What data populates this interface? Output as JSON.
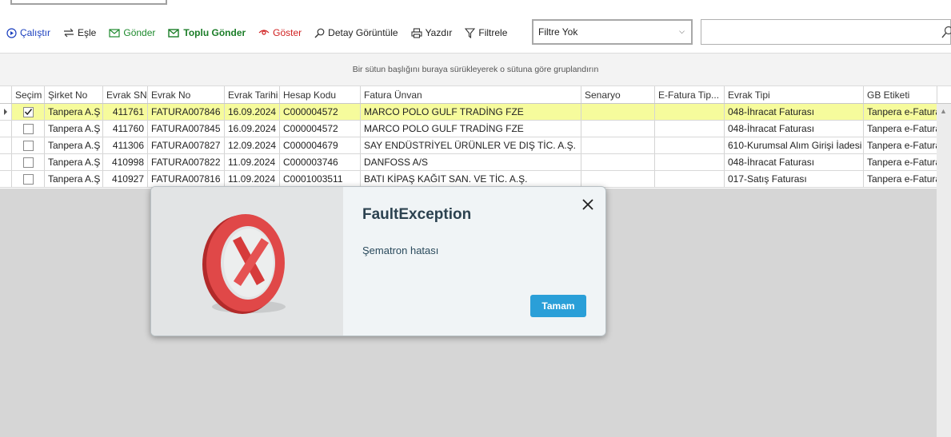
{
  "toolbar": {
    "run_label": "Çalıştır",
    "match_label": "Eşle",
    "send_label": "Gönder",
    "bulk_send_label": "Toplu Gönder",
    "show_label": "Göster",
    "detail_label": "Detay Görüntüle",
    "print_label": "Yazdır",
    "filter_label": "Filtrele",
    "filter_value": "Filtre Yok",
    "search_value": ""
  },
  "group_hint": "Bir sütun başlığını buraya sürükleyerek o sütuna göre gruplandırın",
  "columns": [
    "Seçim",
    "Şirket No",
    "Evrak SN",
    "Evrak No",
    "Evrak Tarihi",
    "Hesap Kodu",
    "Fatura Ünvan",
    "Senaryo",
    "E-Fatura Tip...",
    "Evrak Tipi",
    "GB Etiketi"
  ],
  "rows": [
    {
      "checked": true,
      "sirket": "Tanpera A.Ş",
      "sn": "411761",
      "no": "FATURA007846",
      "tarih": "16.09.2024",
      "hesap": "C000004572",
      "unvan": "MARCO POLO GULF TRADİNG FZE",
      "senaryo": "",
      "tip": "",
      "evrak_tipi": "048-İhracat Faturası",
      "gb": "Tanpera e-Fatura"
    },
    {
      "checked": false,
      "sirket": "Tanpera A.Ş",
      "sn": "411760",
      "no": "FATURA007845",
      "tarih": "16.09.2024",
      "hesap": "C000004572",
      "unvan": "MARCO POLO GULF TRADİNG FZE",
      "senaryo": "",
      "tip": "",
      "evrak_tipi": "048-İhracat Faturası",
      "gb": "Tanpera e-Fatura"
    },
    {
      "checked": false,
      "sirket": "Tanpera A.Ş",
      "sn": "411306",
      "no": "FATURA007827",
      "tarih": "12.09.2024",
      "hesap": "C000004679",
      "unvan": "SAY ENDÜSTRİYEL ÜRÜNLER VE DIŞ TİC. A.Ş.",
      "senaryo": "",
      "tip": "",
      "evrak_tipi": "610-Kurumsal Alım Girişi İadesi",
      "gb": "Tanpera e-Fatura"
    },
    {
      "checked": false,
      "sirket": "Tanpera A.Ş",
      "sn": "410998",
      "no": "FATURA007822",
      "tarih": "11.09.2024",
      "hesap": "C000003746",
      "unvan": "DANFOSS A/S",
      "senaryo": "",
      "tip": "",
      "evrak_tipi": "048-İhracat Faturası",
      "gb": "Tanpera e-Fatura"
    },
    {
      "checked": false,
      "sirket": "Tanpera A.Ş",
      "sn": "410927",
      "no": "FATURA007816",
      "tarih": "11.09.2024",
      "hesap": "C0001003511",
      "unvan": "BATI KİPAŞ KAĞIT SAN. VE TİC. A.Ş.",
      "senaryo": "",
      "tip": "",
      "evrak_tipi": "017-Satış Faturası",
      "gb": "Tanpera e-Fatura"
    }
  ],
  "dialog": {
    "title": "FaultException",
    "message": "Şematron hatası",
    "ok_label": "Tamam",
    "icon": "error-x-icon"
  },
  "colors": {
    "selected_row": "#f6fb9c",
    "ok_button": "#2a9fd8",
    "bulk_send": "#1b7d28",
    "show": "#d02020"
  }
}
